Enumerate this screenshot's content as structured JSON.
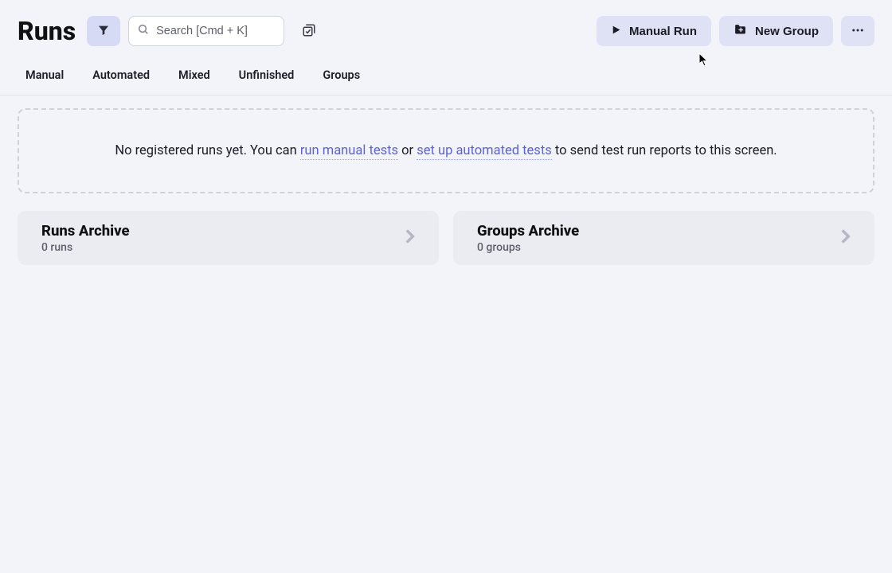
{
  "header": {
    "title": "Runs",
    "search_placeholder": "Search [Cmd + K]",
    "manual_run": "Manual Run",
    "new_group": "New Group"
  },
  "tabs": [
    "Manual",
    "Automated",
    "Mixed",
    "Unfinished",
    "Groups"
  ],
  "empty": {
    "pre": "No registered runs yet. You can ",
    "link1": "run manual tests",
    "mid": " or ",
    "link2": "set up automated tests",
    "post": " to send test run reports to this screen."
  },
  "archives": {
    "runs": {
      "title": "Runs Archive",
      "sub": "0 runs"
    },
    "groups": {
      "title": "Groups Archive",
      "sub": "0 groups"
    }
  }
}
